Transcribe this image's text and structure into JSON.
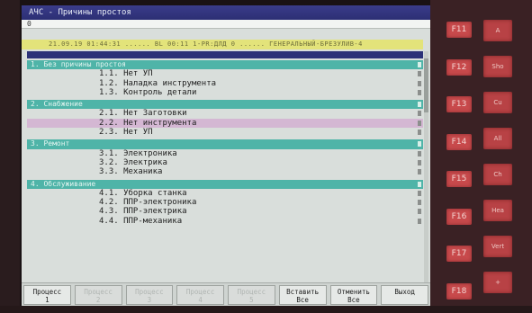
{
  "window": {
    "title": "АЧС - Причины простоя"
  },
  "input_line": {
    "value": "0"
  },
  "status_line": {
    "text": "21.09.19 01:44:31 ...... BL 00:11 1-PR:ДЛД   0 ......  ГЕНЕРАЛЬНЫЙ-БРЕЗУЛИВ-4"
  },
  "groups": [
    {
      "label": "1. Без причины простоя",
      "items": [
        {
          "label": "1.1. Нет УП",
          "selected": false
        },
        {
          "label": "1.2. Наладка инструмента",
          "selected": false
        },
        {
          "label": "1.3. Контроль детали",
          "selected": false
        }
      ]
    },
    {
      "label": "2. Снабжение",
      "items": [
        {
          "label": "2.1. Нет Заготовки",
          "selected": false
        },
        {
          "label": "2.2. Нет инструмента",
          "selected": true
        },
        {
          "label": "2.3. Нет УП",
          "selected": false
        }
      ]
    },
    {
      "label": "3. Ремонт",
      "items": [
        {
          "label": "3.1. Электроника",
          "selected": false
        },
        {
          "label": "3.2. Электрика",
          "selected": false
        },
        {
          "label": "3.3. Механика",
          "selected": false
        }
      ]
    },
    {
      "label": "4. Обслуживание",
      "items": [
        {
          "label": "4.1. Уборка станка",
          "selected": false
        },
        {
          "label": "4.2. ППР-электроника",
          "selected": false
        },
        {
          "label": "4.3. ППР-электрика",
          "selected": false
        },
        {
          "label": "4.4. ППР-механика",
          "selected": false
        }
      ]
    }
  ],
  "softkeys": [
    {
      "line1": "Процесс",
      "line2": "1",
      "enabled": true
    },
    {
      "line1": "Процесс",
      "line2": "2",
      "enabled": false
    },
    {
      "line1": "Процесс",
      "line2": "3",
      "enabled": false
    },
    {
      "line1": "Процесс",
      "line2": "4",
      "enabled": false
    },
    {
      "line1": "Процесс",
      "line2": "5",
      "enabled": false
    },
    {
      "line1": "Вставить",
      "line2": "Все",
      "enabled": true
    },
    {
      "line1": "Отменить",
      "line2": "Все",
      "enabled": true
    },
    {
      "line1": "Выход",
      "line2": "",
      "enabled": true
    }
  ],
  "function_keys": [
    "F11",
    "F12",
    "F13",
    "F14",
    "F15",
    "F16",
    "F17",
    "F18"
  ],
  "side_keys": [
    "A",
    "Sho",
    "Cu",
    "All",
    "Ch",
    "Hea",
    "Vert",
    "+"
  ],
  "colors": {
    "title_bar": "#2c2f74",
    "status_bar": "#e3e37a",
    "group_header": "#4fb4a8",
    "selected_row": "#d4b7d3",
    "hardware_key": "#c84a4c"
  }
}
